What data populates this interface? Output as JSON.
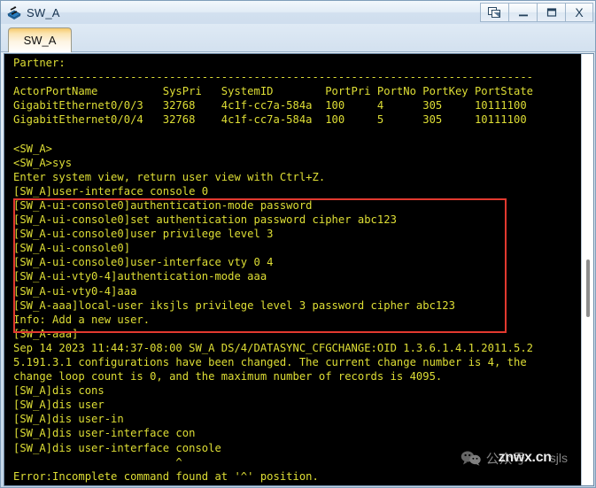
{
  "window": {
    "title": "SW_A",
    "icon": "switch-icon",
    "buttons": [
      {
        "name": "restore-down-button",
        "label": "❐",
        "icon": "cascade-windows-icon"
      },
      {
        "name": "minimize-button",
        "label": "_",
        "icon": "minimize-icon"
      },
      {
        "name": "maximize-button",
        "label": "▭",
        "icon": "maximize-icon"
      },
      {
        "name": "close-button",
        "label": "X",
        "icon": "close-icon"
      }
    ]
  },
  "tabs": [
    {
      "name": "tab-sw-a",
      "label": "SW_A",
      "active": true
    }
  ],
  "terminal": {
    "foreground_color": "#dede35",
    "background_color": "#000000",
    "lines": [
      "Partner:",
      "--------------------------------------------------------------------------------",
      "ActorPortName          SysPri   SystemID        PortPri PortNo PortKey PortState",
      "GigabitEthernet0/0/3   32768    4c1f-cc7a-584a  100     4      305     10111100",
      "GigabitEthernet0/0/4   32768    4c1f-cc7a-584a  100     5      305     10111100",
      "",
      "<SW_A>",
      "<SW_A>sys",
      "Enter system view, return user view with Ctrl+Z.",
      "[SW_A]user-interface console 0",
      "[SW_A-ui-console0]authentication-mode password",
      "[SW_A-ui-console0]set authentication password cipher abc123",
      "[SW_A-ui-console0]user privilege level 3",
      "[SW_A-ui-console0]",
      "[SW_A-ui-console0]user-interface vty 0 4",
      "[SW_A-ui-vty0-4]authentication-mode aaa",
      "[SW_A-ui-vty0-4]aaa",
      "[SW_A-aaa]local-user iksjls privilege level 3 password cipher abc123",
      "Info: Add a new user.",
      "[SW_A-aaa]",
      "Sep 14 2023 11:44:37-08:00 SW_A DS/4/DATASYNC_CFGCHANGE:OID 1.3.6.1.4.1.2011.5.2",
      "5.191.3.1 configurations have been changed. The current change number is 4, the",
      "change loop count is 0, and the maximum number of records is 4095.",
      "[SW_A]dis cons",
      "[SW_A]dis user",
      "[SW_A]dis user-in",
      "[SW_A]dis user-interface con",
      "[SW_A]dis user-interface console",
      "                         ^",
      "Error:Incomplete command found at '^' position."
    ]
  },
  "annotation": {
    "name": "red-highlight-box",
    "color": "#e2392f",
    "covers_lines": [
      "[SW_A-ui-console0]authentication-mode password",
      "[SW_A-ui-console0]set authentication password cipher abc123",
      "[SW_A-ui-console0]user privilege level 3",
      "[SW_A-ui-console0]",
      "[SW_A-ui-console0]user-interface vty 0 4",
      "[SW_A-ui-vty0-4]authentication-mode aaa",
      "[SW_A-ui-vty0-4]aaa",
      "[SW_A-aaa]local-user iksjls privilege level 3 password cipher abc123",
      "Info: Add a new user."
    ]
  },
  "scrollbar": {
    "name": "vertical-scrollbar",
    "thumb_position_percent": 48
  },
  "watermark": {
    "logo": "wechat-icon",
    "prefix": "公众号",
    "site": "znwx.cn",
    "tail": "sjls"
  }
}
